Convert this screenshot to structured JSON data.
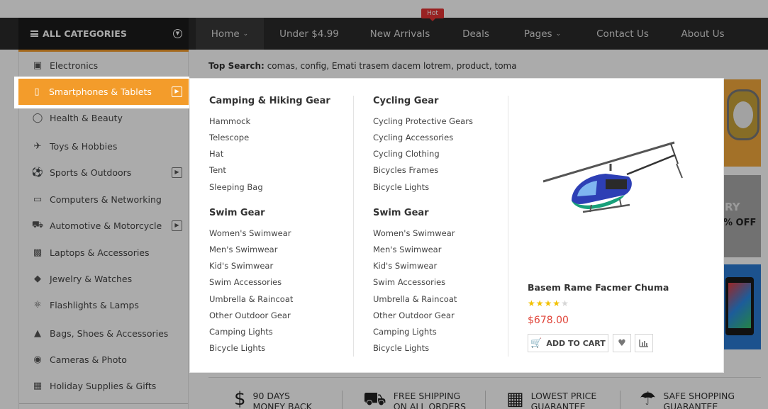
{
  "nav": {
    "all_categories": "ALL CATEGORIES",
    "hot_badge": "Hot",
    "items": [
      {
        "label": "Home",
        "has_dropdown": true
      },
      {
        "label": "Under $4.99"
      },
      {
        "label": "New Arrivals"
      },
      {
        "label": "Deals"
      },
      {
        "label": "Pages",
        "has_dropdown": true
      },
      {
        "label": "Contact Us"
      },
      {
        "label": "About Us"
      }
    ]
  },
  "sidebar": {
    "items": [
      {
        "label": "Electronics",
        "icon": "ipod-icon",
        "submenu": false
      },
      {
        "label": "Smartphones & Tablets",
        "icon": "smartphone-icon",
        "submenu": true,
        "active": true
      },
      {
        "label": "Health & Beauty",
        "icon": "bottle-icon",
        "submenu": false
      },
      {
        "label": "Toys & Hobbies",
        "icon": "toy-plane-icon",
        "submenu": false
      },
      {
        "label": "Sports & Outdoors",
        "icon": "sports-icon",
        "submenu": true
      },
      {
        "label": "Computers & Networking",
        "icon": "monitor-icon",
        "submenu": false
      },
      {
        "label": "Automotive & Motorcycle",
        "icon": "car-icon",
        "submenu": true
      },
      {
        "label": "Laptops & Accessories",
        "icon": "laptop-icon",
        "submenu": false
      },
      {
        "label": "Jewelry & Watches",
        "icon": "diamond-icon",
        "submenu": false
      },
      {
        "label": "Flashlights & Lamps",
        "icon": "flashlight-icon",
        "submenu": false
      },
      {
        "label": "Bags, Shoes & Accessories",
        "icon": "bag-icon",
        "submenu": false
      },
      {
        "label": "Cameras & Photo",
        "icon": "camera-icon",
        "submenu": false
      },
      {
        "label": "Holiday Supplies & Gifts",
        "icon": "gift-icon",
        "submenu": false
      }
    ]
  },
  "top_search": {
    "label": "Top Search:",
    "terms": "comas, config, Emati trasem dacem lotrem, product, toma"
  },
  "banners": {
    "sale_fragment": "RY",
    "off_fragment": "% OFF"
  },
  "mega_menu": {
    "col1": {
      "group1": {
        "title": "Camping & Hiking Gear",
        "links": [
          "Hammock",
          "Telescope",
          "Hat",
          "Tent",
          "Sleeping Bag"
        ]
      },
      "group2": {
        "title": "Swim Gear",
        "links": [
          "Women's Swimwear",
          "Men's Swimwear",
          "Kid's Swimwear",
          "Swim Accessories",
          "Umbrella & Raincoat",
          "Other Outdoor Gear",
          "Camping Lights",
          "Bicycle Lights"
        ]
      }
    },
    "col2": {
      "group1": {
        "title": "Cycling Gear",
        "links": [
          "Cycling Protective Gears",
          "Cycling Accessories",
          "Cycling Clothing",
          "Bicycles Frames",
          "Bicycle Lights"
        ]
      },
      "group2": {
        "title": "Swim Gear",
        "links": [
          "Women's Swimwear",
          "Men's Swimwear",
          "Kid's Swimwear",
          "Swim Accessories",
          "Umbrella & Raincoat",
          "Other Outdoor Gear",
          "Camping Lights",
          "Bicycle Lights"
        ]
      }
    },
    "product": {
      "name": "Basem Rame Facmer Chuma",
      "rating": 3.5,
      "rating_max": 5,
      "price": "$678.00",
      "add_to_cart": "ADD TO CART",
      "wishlist_icon": "heart-icon",
      "compare_icon": "bar-chart-icon"
    }
  },
  "features": [
    {
      "icon": "dollar-icon",
      "line1": "90 DAYS",
      "line2": "MONEY BACK"
    },
    {
      "icon": "truck-icon",
      "line1": "FREE SHIPPING",
      "line2": "ON ALL ORDERS"
    },
    {
      "icon": "calendar-icon",
      "line1": "LOWEST PRICE",
      "line2": "GUARANTEE"
    },
    {
      "icon": "umbrella-icon",
      "line1": "SAFE SHOPPING",
      "line2": "GUARANTEE"
    }
  ],
  "colors": {
    "accent": "#f39c2b",
    "nav_bg": "#2a2a2a",
    "price": "#e0453a",
    "hot": "#e53434"
  }
}
